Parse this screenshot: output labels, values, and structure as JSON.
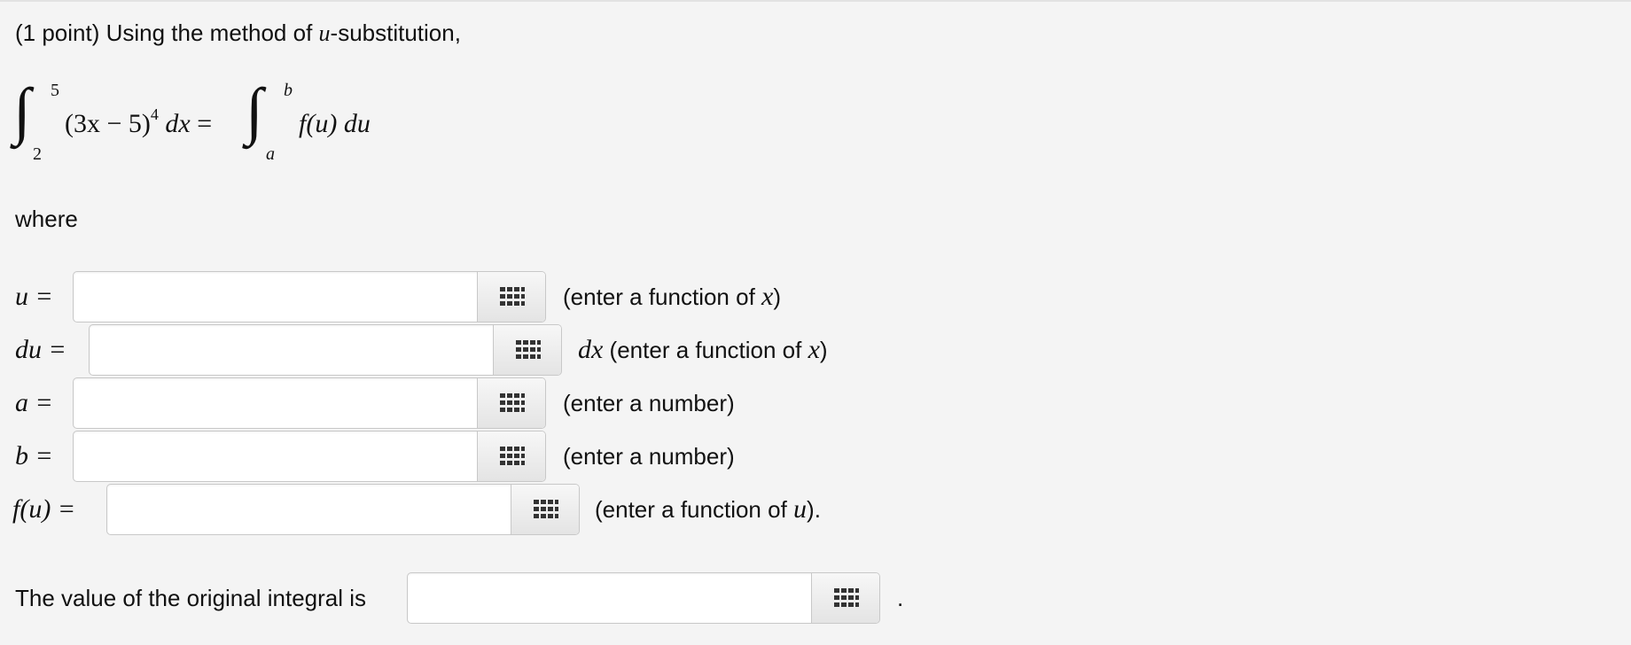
{
  "intro": {
    "prefix": "(1 point) Using the method of ",
    "u_var": "u",
    "suffix": "-substitution,"
  },
  "integral": {
    "lhs_lower": "2",
    "lhs_upper": "5",
    "lhs_integrand": "(3x − 5)",
    "lhs_exponent": "4",
    "lhs_differential": "dx",
    "equals": "=",
    "rhs_lower": "a",
    "rhs_upper": "b",
    "rhs_integrand": "f(u) du"
  },
  "where_text": "where",
  "fields": [
    {
      "label": "u =",
      "value": "",
      "hint_prefix": "(enter a function of ",
      "hint_var": "x",
      "hint_suffix": ")"
    },
    {
      "label": "du =",
      "value": "",
      "hint_pre_var": "dx",
      "hint_prefix": " (enter a function of ",
      "hint_var": "x",
      "hint_suffix": ")"
    },
    {
      "label": "a =",
      "value": "",
      "hint_prefix": "(enter a number)"
    },
    {
      "label": "b =",
      "value": "",
      "hint_prefix": "(enter a number)"
    },
    {
      "label": "f(u) =",
      "value": "",
      "hint_prefix": "(enter a function of ",
      "hint_var": "u",
      "hint_suffix": ")."
    }
  ],
  "final": {
    "text": "The value of the original integral is",
    "value": "",
    "period": "."
  },
  "icons": {
    "palette": "equation-palette-grid-icon"
  }
}
